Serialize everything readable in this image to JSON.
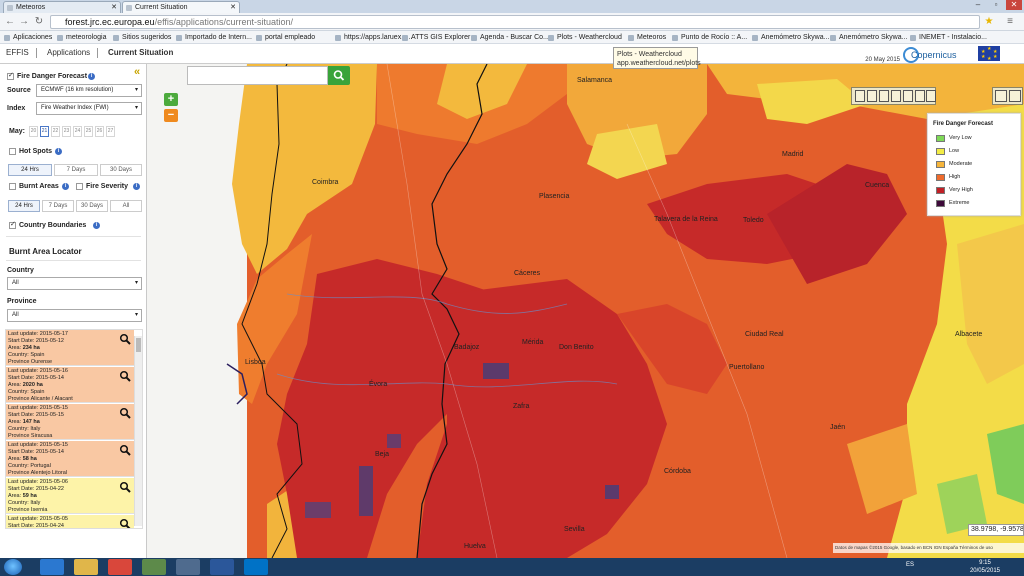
{
  "browser": {
    "tabs": [
      {
        "label": "Meteoros",
        "active": false
      },
      {
        "label": "Current Situation",
        "active": true
      }
    ],
    "url_domain": "forest.jrc.ec.europa.eu",
    "url_path": "/effis/applications/current-situation/",
    "bookmarks": [
      "Aplicaciones",
      "meteorologia",
      "Sitios sugeridos",
      "Importado de Intern...",
      "portal empleado",
      "https://apps.laruex.c...",
      "ATTS GIS Explorer",
      "Agenda - Buscar Co...",
      "Plots - Weathercloud",
      "Meteoros",
      "Punto de Rocío :: A...",
      "Anemómetro Skywa...",
      "Anemómetro Skywa...",
      "INEMET - Instalacio..."
    ],
    "tooltip": {
      "title": "Plots - Weathercloud",
      "url": "app.weathercloud.net/plots"
    }
  },
  "app": {
    "nav": [
      "EFFIS",
      "Applications",
      "Current Situation"
    ],
    "date": "20 May 2015",
    "logo_text": "Copernicus",
    "eu_text": "European Commission"
  },
  "sidebar": {
    "fire_danger_label": "Fire Danger Forecast",
    "source_label": "Source",
    "source_value": "ECMWF (16 km resolution)",
    "index_label": "Index",
    "index_value": "Fire Weather Index (FWI)",
    "may_label": "May:",
    "days": [
      "20",
      "21",
      "22",
      "23",
      "24",
      "25",
      "26",
      "27"
    ],
    "active_day": "21",
    "hotspots_label": "Hot Spots",
    "hotspot_periods": [
      "24 Hrs",
      "7 Days",
      "30 Days"
    ],
    "burnt_areas_label": "Burnt Areas",
    "fire_severity_label": "Fire Severity",
    "burnt_periods": [
      "24 Hrs",
      "7 Days",
      "30 Days",
      "All"
    ],
    "country_boundaries_label": "Country Boundaries",
    "locator_title": "Burnt Area Locator",
    "country_label": "Country",
    "country_value": "All",
    "province_label": "Province",
    "province_value": "All",
    "results": [
      {
        "update": "Last update: 2015-05-17",
        "start": "Start Date: 2015-05-12",
        "area_label": "Area:",
        "area": "234 ha",
        "country": "Country: Spain",
        "province": "Province Ourense",
        "color": "#f9c8a3"
      },
      {
        "update": "Last update: 2015-05-16",
        "start": "Start Date: 2015-05-14",
        "area_label": "Area:",
        "area": "2020 ha",
        "country": "Country: Spain",
        "province": "Province Alicante / Alacant",
        "color": "#f9c8a3"
      },
      {
        "update": "Last update: 2015-05-15",
        "start": "Start Date: 2015-05-15",
        "area_label": "Area:",
        "area": "147 ha",
        "country": "Country: Italy",
        "province": "Province Siracusa",
        "color": "#f9c8a3"
      },
      {
        "update": "Last update: 2015-05-15",
        "start": "Start Date: 2015-05-14",
        "area_label": "Area:",
        "area": "58 ha",
        "country": "Country: Portugal",
        "province": "Province Alentejo Litoral",
        "color": "#f9c8a3"
      },
      {
        "update": "Last update: 2015-05-06",
        "start": "Start Date: 2015-04-22",
        "area_label": "Area:",
        "area": "59 ha",
        "country": "Country: Italy",
        "province": "Province Isernia",
        "color": "#fdf3a8"
      },
      {
        "update": "Last update: 2015-05-05",
        "start": "Start Date: 2015-04-24",
        "area_label": "",
        "area": "",
        "country": "",
        "province": "",
        "color": "#fdf3a8"
      }
    ]
  },
  "legend": {
    "title": "Fire Danger Forecast",
    "items": [
      {
        "label": "Very Low",
        "color": "#7ed957"
      },
      {
        "label": "Low",
        "color": "#f3ec45"
      },
      {
        "label": "Moderate",
        "color": "#f6b53b"
      },
      {
        "label": "High",
        "color": "#ef6b2c"
      },
      {
        "label": "Very High",
        "color": "#c22026"
      },
      {
        "label": "Extreme",
        "color": "#3d0a3a"
      }
    ]
  },
  "map": {
    "cities": [
      "Salamanca",
      "Madrid",
      "Coimbra",
      "Toledo",
      "Cáceres",
      "Lisboa",
      "Badajoz",
      "Mérida",
      "Ciudad Real",
      "Córdoba",
      "Sevilla",
      "Huelva",
      "Beja",
      "Évora",
      "Cuenca",
      "Albacete",
      "Jaén",
      "Plasencia",
      "Talavera de la Reina",
      "Puertollano",
      "Don Benito",
      "Zafra"
    ],
    "coords": "38.9798, -9.9578",
    "attribution": "Datos de mapas ©2015 Google, basado en BCN IGN España   Términos de uso"
  },
  "taskbar": {
    "lang": "ES",
    "time": "9:15",
    "date": "20/05/2015"
  }
}
